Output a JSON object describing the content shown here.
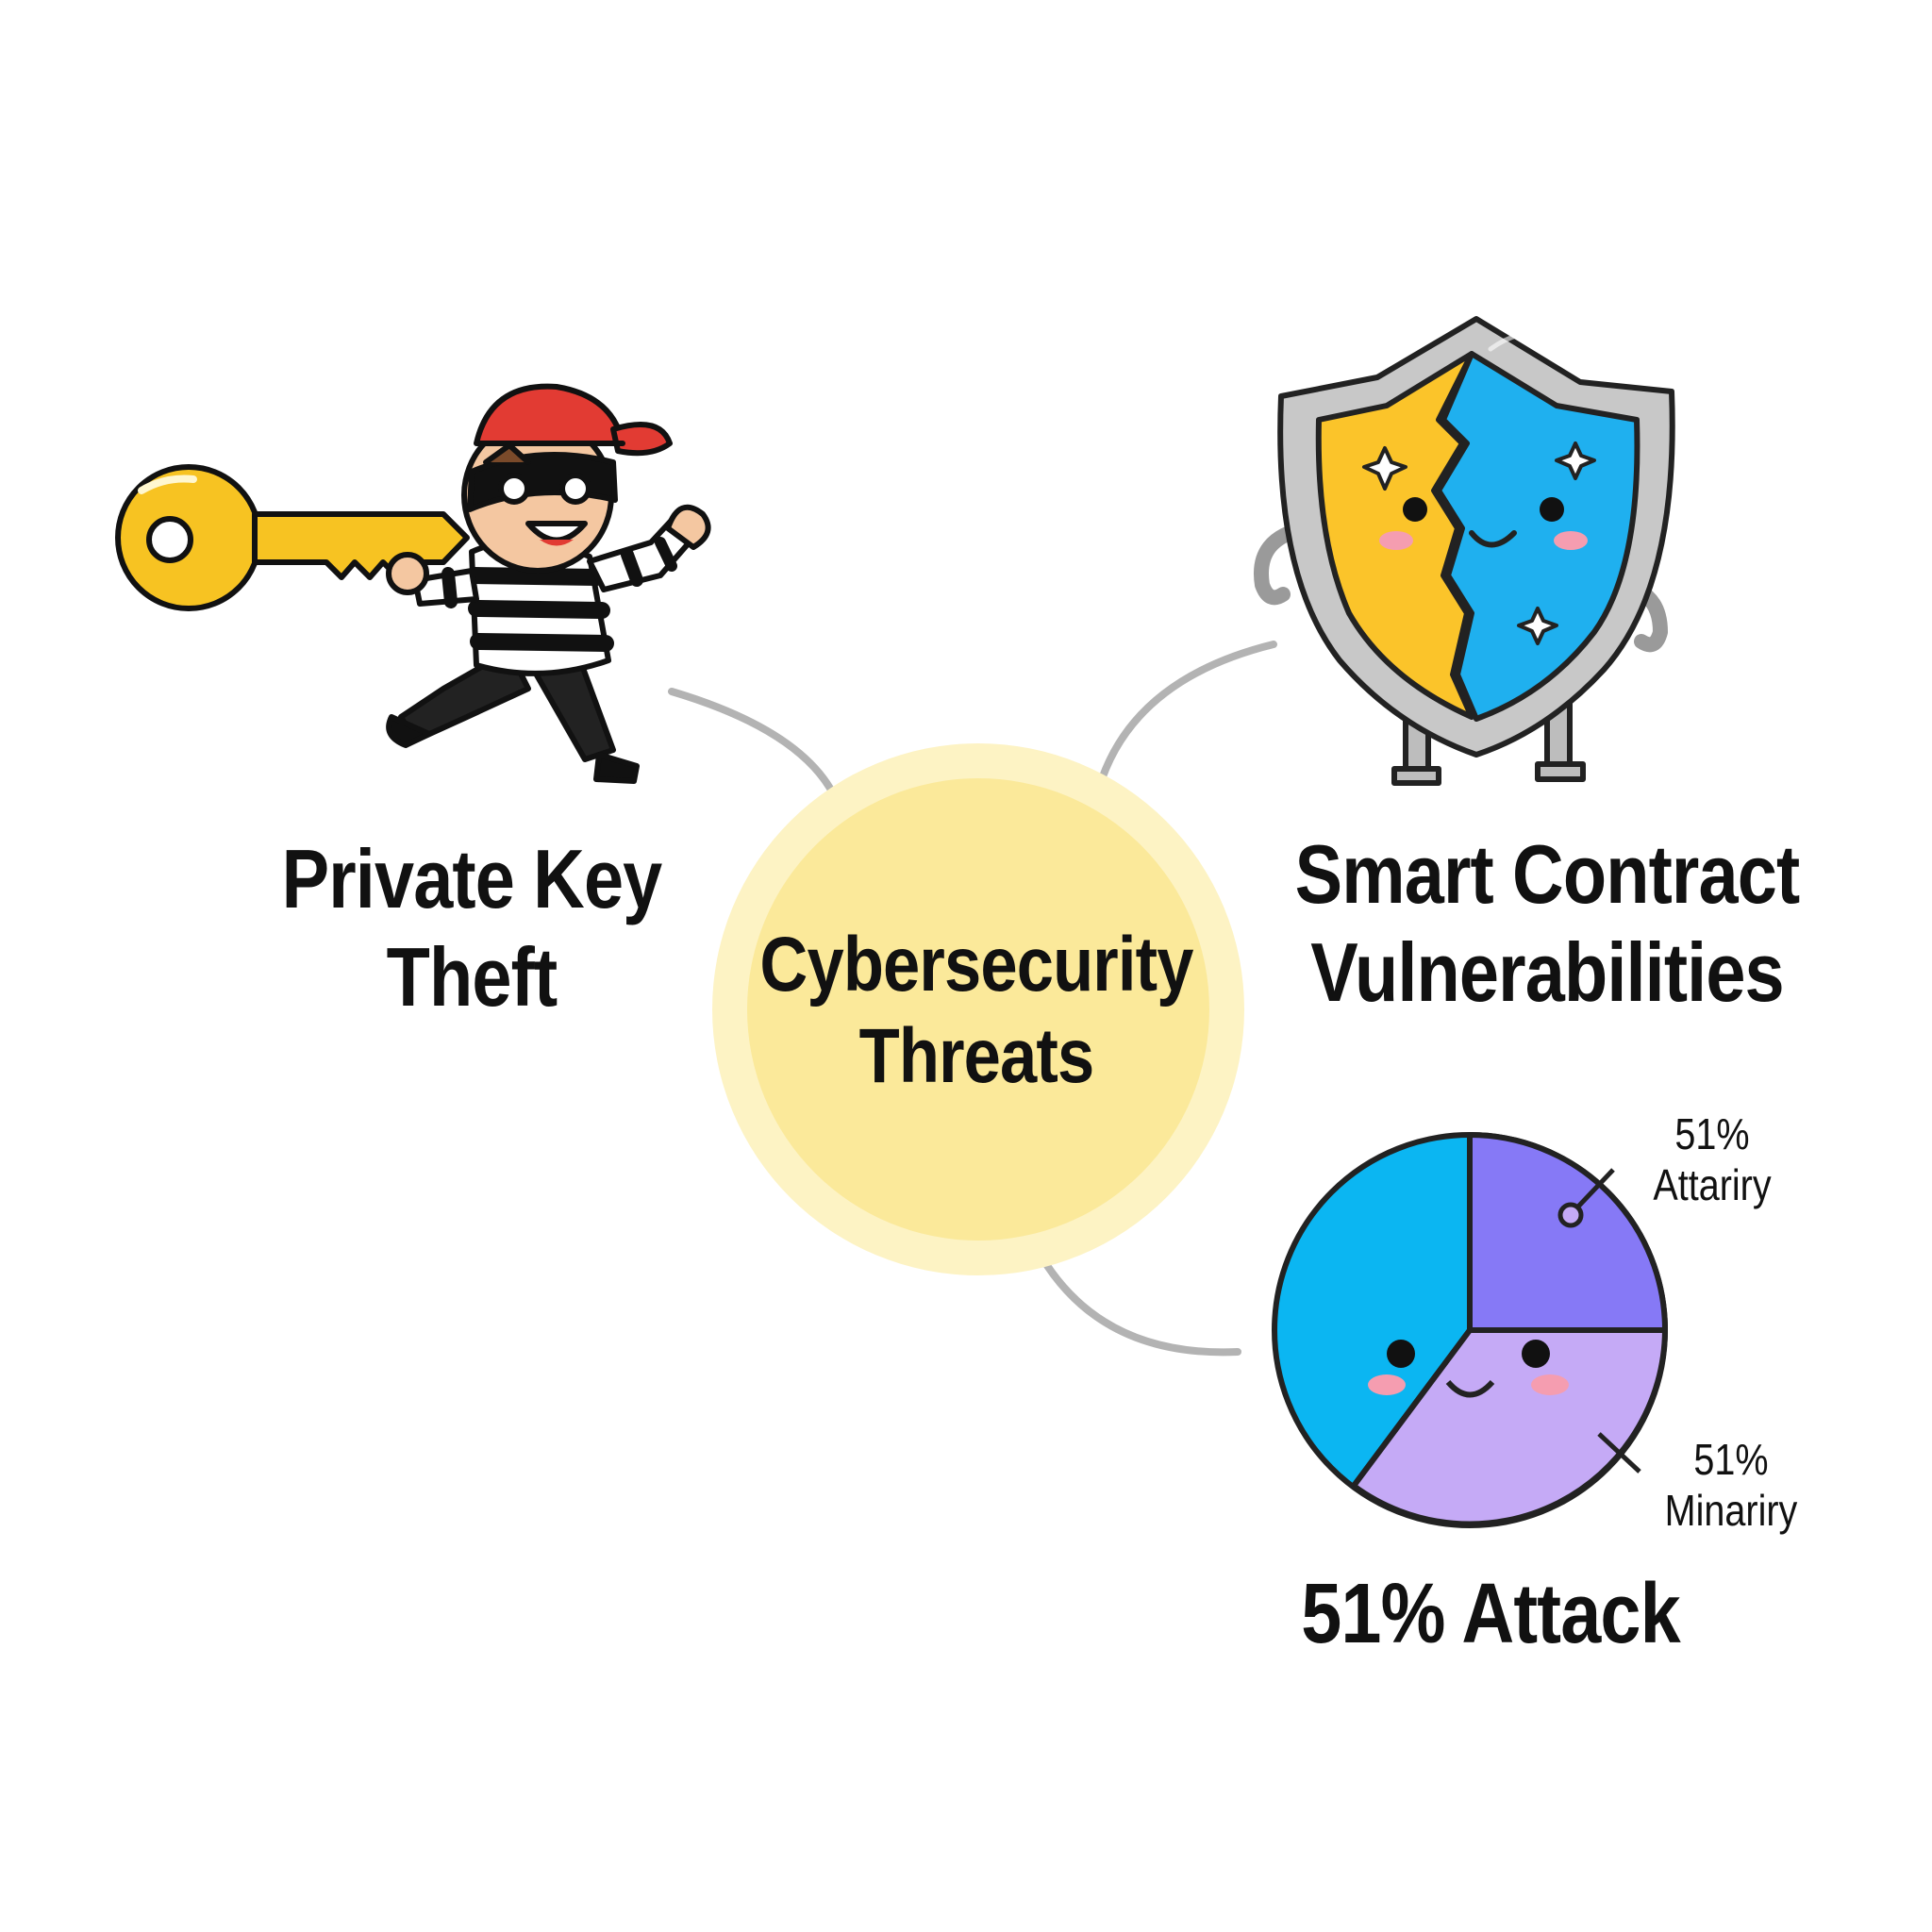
{
  "center": {
    "line1": "Cybersecurity",
    "line2": "Threats"
  },
  "nodes": [
    {
      "id": "private-key-theft",
      "line1": "Private Key",
      "line2": "Theft",
      "icon": "thief-with-key-icon"
    },
    {
      "id": "smart-contract-vulnerabilities",
      "line1": "Smart Contract",
      "line2": "Vulnerabilities",
      "icon": "cracked-shield-icon"
    },
    {
      "id": "51-attack",
      "line1": "51% Attack",
      "icon": "pie-chart-face-icon"
    }
  ],
  "pie": {
    "labels": [
      {
        "percent": "51%",
        "text": "Attariry"
      },
      {
        "percent": "51%",
        "text": "Minariry"
      }
    ]
  },
  "colors": {
    "center_fill": "#fbe99a",
    "center_halo": "#fdf3c4",
    "connector": "#b3b3b3",
    "key_gold": "#f7c322",
    "hat_red": "#e23b33",
    "shield_yellow": "#fbc42a",
    "shield_blue": "#1fb0ef",
    "shield_frame": "#c8c8c8",
    "pie_blue": "#0bb6f2",
    "pie_violet": "#8679f6",
    "pie_lavender": "#c5aaf6"
  }
}
